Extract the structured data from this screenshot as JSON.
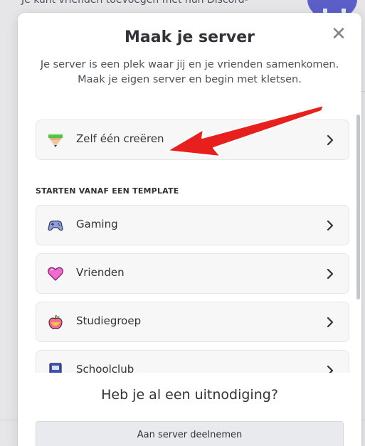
{
  "background": {
    "hint_text": "Je kunt vrienden toevoegen met hun Discord-"
  },
  "modal": {
    "title": "Maak je server",
    "subtitle": "Je server is een plek waar jij en je vrienden samenkomen. Maak je eigen server en begin met kletsen.",
    "close_icon": "close-icon",
    "create_option": {
      "label": "Zelf één creëren",
      "icon": "pencil-icon"
    },
    "template_section_label": "STARTEN VANAF EEN TEMPLATE",
    "templates": [
      {
        "label": "Gaming",
        "icon": "gamepad-icon"
      },
      {
        "label": "Vrienden",
        "icon": "heart-icon"
      },
      {
        "label": "Studiegroep",
        "icon": "apple-icon"
      },
      {
        "label": "Schoolclub",
        "icon": "book-icon"
      }
    ],
    "footer": {
      "title": "Heb je al een uitnodiging?",
      "join_label": "Aan server deelnemen"
    }
  },
  "colors": {
    "modal_bg": "#ffffff",
    "option_bg": "#f7f7f8",
    "text": "#313338",
    "annotation_arrow": "#e8201d"
  }
}
